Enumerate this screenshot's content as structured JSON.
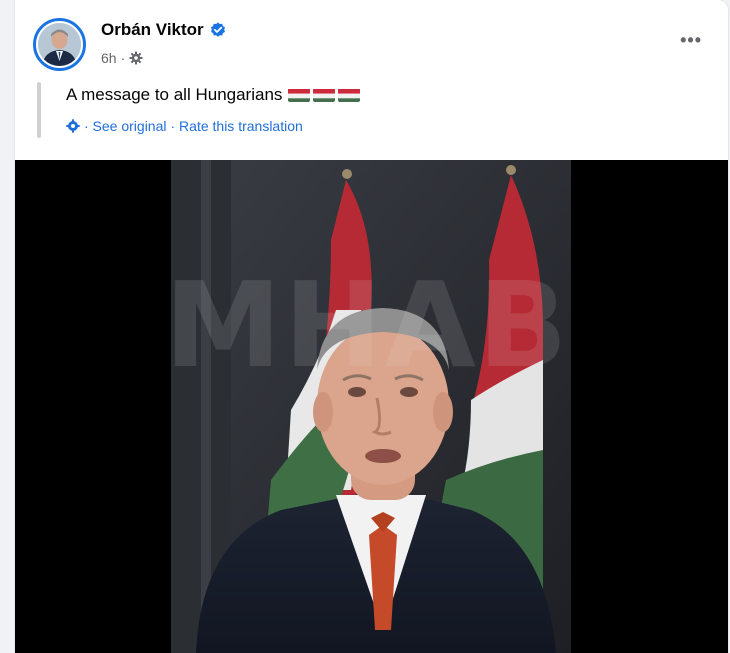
{
  "post": {
    "author_name": "Orbán Viktor",
    "timestamp": "6h",
    "meta_separator": "·",
    "more_label": "•••",
    "text": "A message to all Hungarians",
    "see_original_label": "· See original",
    "rate_translation_label": "· Rate this translation",
    "video": {
      "watermark_text": "MHAB"
    }
  },
  "icons": {
    "verified": "verified-badge-icon",
    "audience": "gear-icon",
    "translate": "translate-icon",
    "flag": "hungary-flag-icon",
    "more": "more-options-icon"
  },
  "colors": {
    "link_blue": "#216fdb",
    "verified_blue": "#1b74e4",
    "name_text": "#050505",
    "meta_text": "#65676b",
    "video_bg": "#000000",
    "flag_red": "#cd2a3e",
    "flag_white": "#ffffff",
    "flag_green": "#436f4d"
  }
}
